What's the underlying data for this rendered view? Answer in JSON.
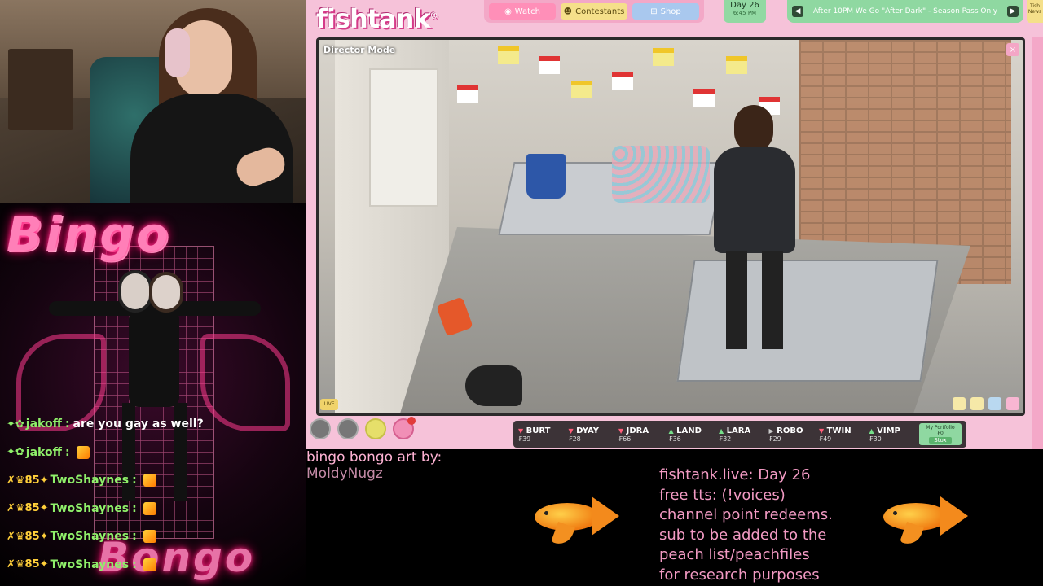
{
  "webcam": {
    "label": ""
  },
  "bingo": {
    "title_top": "Bingo",
    "title_bottom": "Bongo"
  },
  "chat": [
    {
      "user": "jakoff",
      "text": "are you gay as well?",
      "badges": "✦✿",
      "has_emote": false
    },
    {
      "user": "jakoff",
      "text": "",
      "badges": "✦✿",
      "has_emote": true
    },
    {
      "user": "TwoShaynes",
      "text": "",
      "badges": "✗♛85✦",
      "has_emote": true
    },
    {
      "user": "TwoShaynes",
      "text": "",
      "badges": "✗♛85✦",
      "has_emote": true
    },
    {
      "user": "TwoShaynes",
      "text": "",
      "badges": "✗♛85✦",
      "has_emote": true
    },
    {
      "user": "TwoShaynes",
      "text": "",
      "badges": "✗♛85✦",
      "has_emote": true
    }
  ],
  "site": {
    "logo": "fishtank",
    "nav": {
      "watch": "Watch",
      "contestants": "Contestants",
      "shop": "Shop"
    },
    "day": {
      "label": "Day 26",
      "time": "6:45 PM"
    },
    "ticker_text": "After 10PM We Go \"After Dark\" - Season Pass Only",
    "tiny_tag": "Tish News",
    "video": {
      "mode_label": "Director Mode",
      "close": "×",
      "live_tag": "LIVE"
    },
    "stocks": [
      {
        "name": "BURT",
        "value": "₣39",
        "dir": "down"
      },
      {
        "name": "DYAY",
        "value": "₣28",
        "dir": "down"
      },
      {
        "name": "JDRA",
        "value": "₣66",
        "dir": "down"
      },
      {
        "name": "LAND",
        "value": "₣36",
        "dir": "up"
      },
      {
        "name": "LARA",
        "value": "₣32",
        "dir": "up"
      },
      {
        "name": "ROBO",
        "value": "₣29",
        "dir": "flat"
      },
      {
        "name": "TWIN",
        "value": "₣49",
        "dir": "down"
      },
      {
        "name": "VIMP",
        "value": "₣30",
        "dir": "up"
      }
    ],
    "portfolio": {
      "title": "My Portfolio",
      "value": "₣0",
      "button": "Stox"
    }
  },
  "credit": {
    "line1": "bingo bongo art by:",
    "line2": "MoldyNugz"
  },
  "info": [
    "fishtank.live: Day 26",
    "free tts: (!voices)",
    "channel point redeems.",
    "sub to be added to the",
    "peach list/peachfiles",
    "for research purposes"
  ],
  "colors": {
    "site_bg": "#f6c2d9",
    "caption_pink": "#f29ac3",
    "chat_name": "#8ff06a"
  }
}
